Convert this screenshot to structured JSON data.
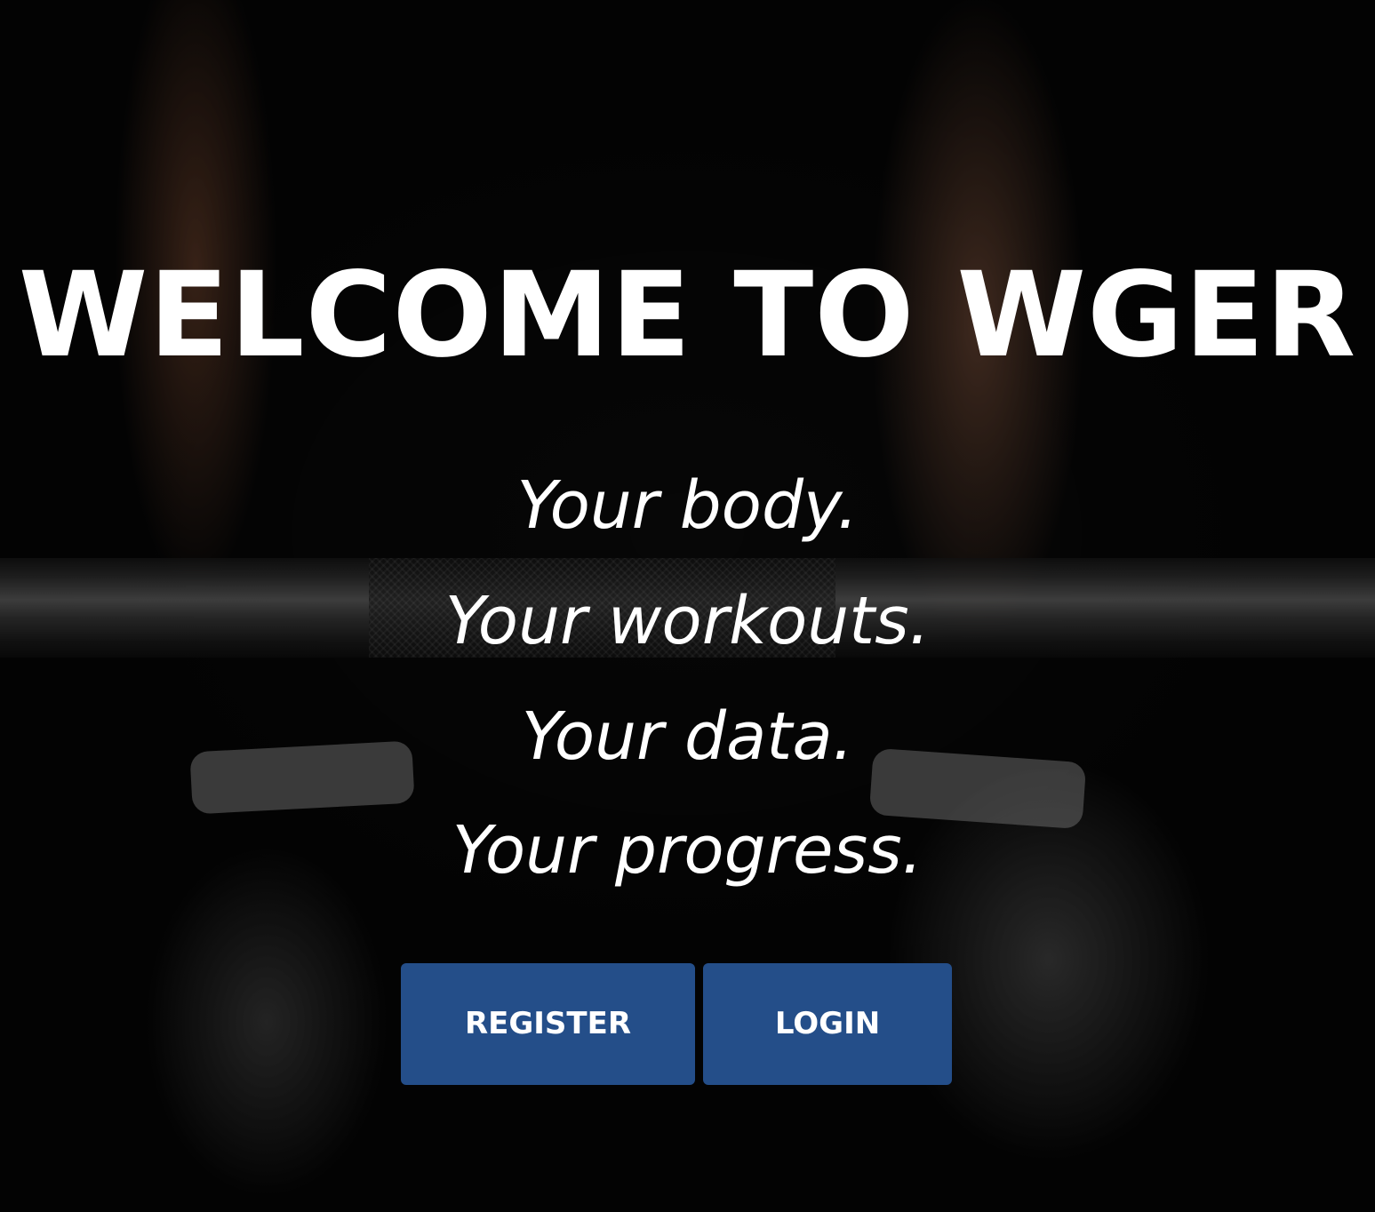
{
  "hero": {
    "title": "WELCOME TO WGER",
    "taglines": [
      "Your body.",
      "Your workouts.",
      "Your data.",
      "Your progress."
    ]
  },
  "actions": {
    "register_label": "REGISTER",
    "login_label": "LOGIN"
  },
  "colors": {
    "button_bg": "#244e89",
    "text": "#ffffff",
    "background": "#0b0b0b"
  }
}
